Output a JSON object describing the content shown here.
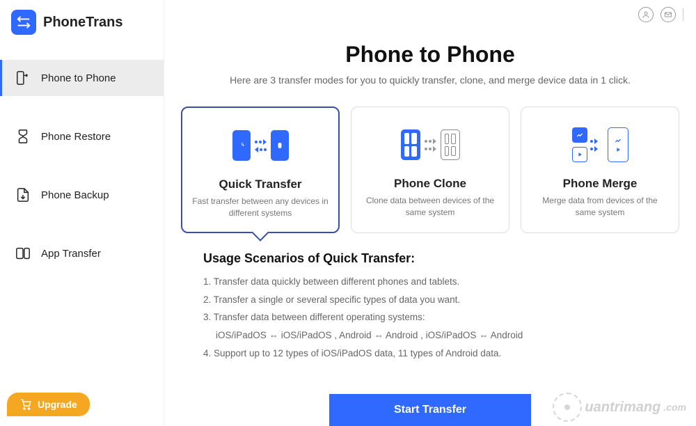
{
  "brand": {
    "name": "PhoneTrans"
  },
  "sidebar": {
    "items": [
      {
        "label": "Phone to Phone"
      },
      {
        "label": "Phone Restore"
      },
      {
        "label": "Phone Backup"
      },
      {
        "label": "App Transfer"
      }
    ],
    "upgrade": "Upgrade"
  },
  "page": {
    "title": "Phone to Phone",
    "subtitle": "Here are 3 transfer modes for you to quickly transfer, clone, and merge device data in 1 click."
  },
  "cards": [
    {
      "title": "Quick Transfer",
      "desc": "Fast transfer between any devices in different systems"
    },
    {
      "title": "Phone Clone",
      "desc": "Clone data between devices of the same system"
    },
    {
      "title": "Phone Merge",
      "desc": "Merge data from devices of the same system"
    }
  ],
  "scenarios": {
    "heading": "Usage Scenarios of Quick Transfer:",
    "lines": [
      "1. Transfer data quickly between different phones and tablets.",
      "2. Transfer a single or several specific types of data you want.",
      "3. Transfer data between different operating systems:",
      "iOS/iPadOS ⇔ iOS/iPadOS ,   Android ⇔ Android ,   iOS/iPadOS ⇔ Android",
      "4. Support up to 12 types of iOS/iPadOS data, 11 types of Android data."
    ]
  },
  "cta": {
    "start": "Start Transfer"
  },
  "watermark": "uantrimang"
}
